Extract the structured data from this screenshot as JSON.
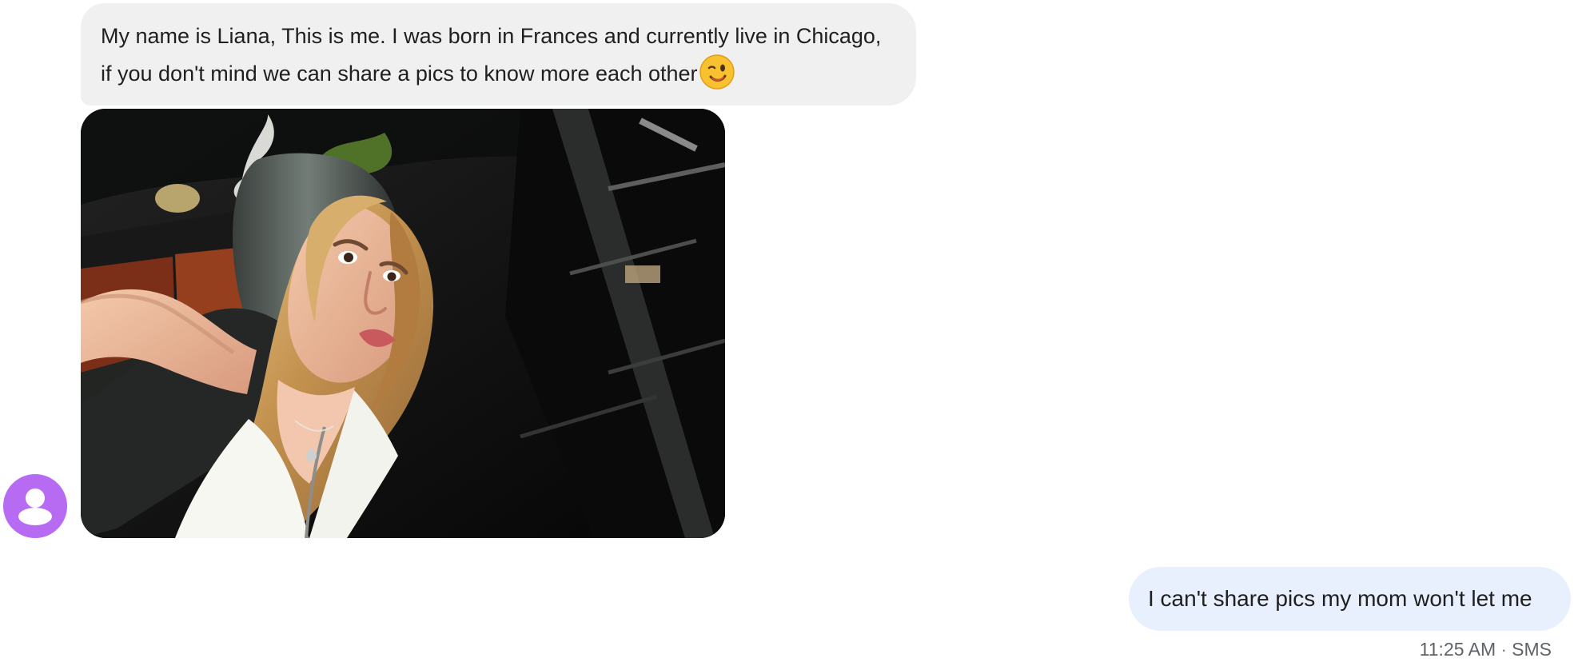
{
  "conversation": {
    "incoming": {
      "message": "My name is Liana, This is me. I was born in Frances and currently live in Chicago, if you don't mind we can share a pics to know more each other",
      "emoji_icon": "winking-face-emoji",
      "avatar_icon": "person-icon",
      "avatar_color": "#b66bf2",
      "image_icon": "photo-attachment"
    },
    "outgoing": {
      "message": "I can't share pics my mom won't let me",
      "time": "11:25 AM",
      "separator": "·",
      "channel": "SMS"
    }
  },
  "colors": {
    "incoming_bubble": "#f0f0f0",
    "outgoing_bubble": "#e8f0fe",
    "text": "#1f1f1f",
    "meta_text": "#5f6368"
  }
}
